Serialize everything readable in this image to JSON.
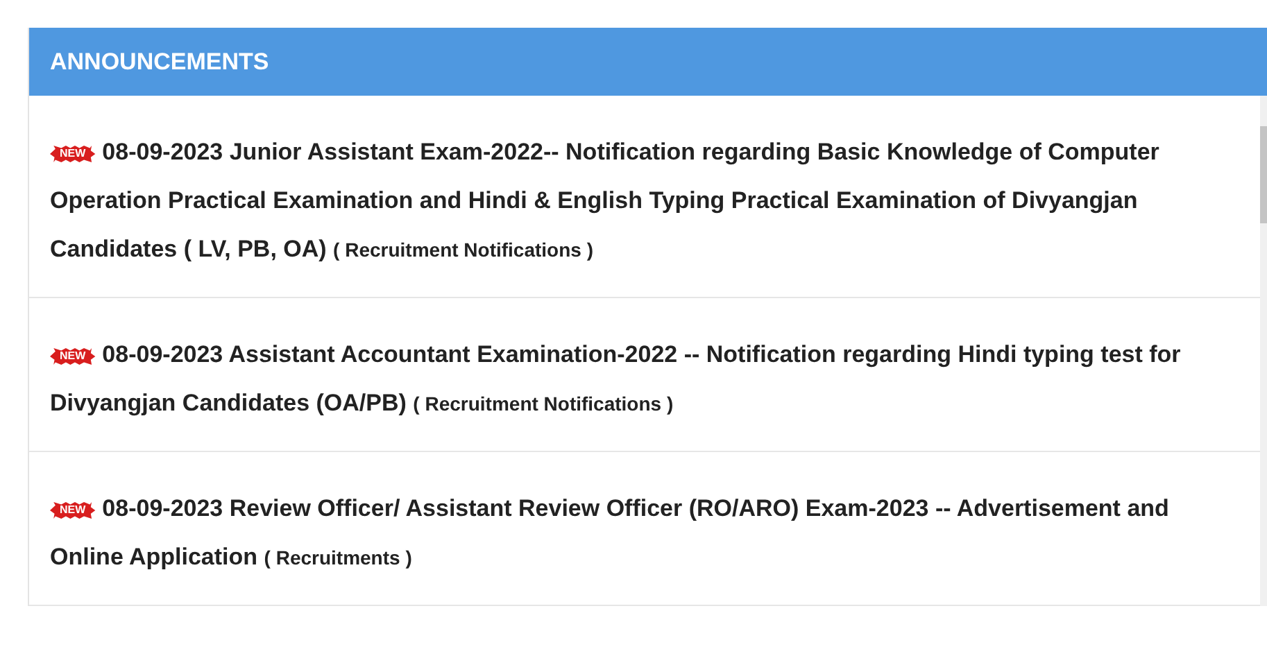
{
  "panel": {
    "title": "ANNOUNCEMENTS"
  },
  "announcements": [
    {
      "badge": "NEW",
      "text": "08-09-2023 Junior Assistant Exam-2022-- Notification regarding Basic Knowledge of Computer Operation Practical Examination and Hindi & English Typing Practical Examination of Divyangjan Candidates ( LV, PB, OA)",
      "category": "( Recruitment Notifications )"
    },
    {
      "badge": "NEW",
      "text": "08-09-2023 Assistant Accountant Examination-2022 -- Notification regarding Hindi typing test for Divyangjan Candidates (OA/PB)",
      "category": "( Recruitment Notifications )"
    },
    {
      "badge": "NEW",
      "text": "08-09-2023 Review Officer/ Assistant Review Officer (RO/ARO) Exam-2023 -- Advertisement and Online Application",
      "category": "( Recruitments )"
    }
  ]
}
